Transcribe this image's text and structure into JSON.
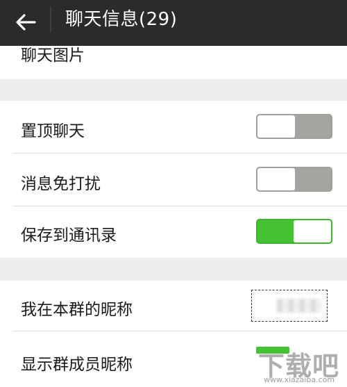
{
  "header": {
    "title": "聊天信息(29)"
  },
  "sections": {
    "chat_images_label": "聊天图片",
    "pin_chat_label": "置顶聊天",
    "mute_label": "消息免打扰",
    "save_contacts_label": "保存到通讯录",
    "my_nickname_label": "我在本群的昵称",
    "show_member_nicknames_label": "显示群成员昵称"
  },
  "toggles": {
    "pin_chat": "off",
    "mute": "off",
    "save_contacts": "on",
    "show_member_nicknames": "on"
  },
  "watermark": {
    "logo_text": "下载吧",
    "url": "www.xiazaiba.com"
  },
  "colors": {
    "header_bg": "#2b2b2b",
    "toggle_on": "#45c233",
    "toggle_off": "#a3a59f",
    "page_bg": "#ededed"
  },
  "icons": {
    "back": "arrow-left-icon"
  }
}
